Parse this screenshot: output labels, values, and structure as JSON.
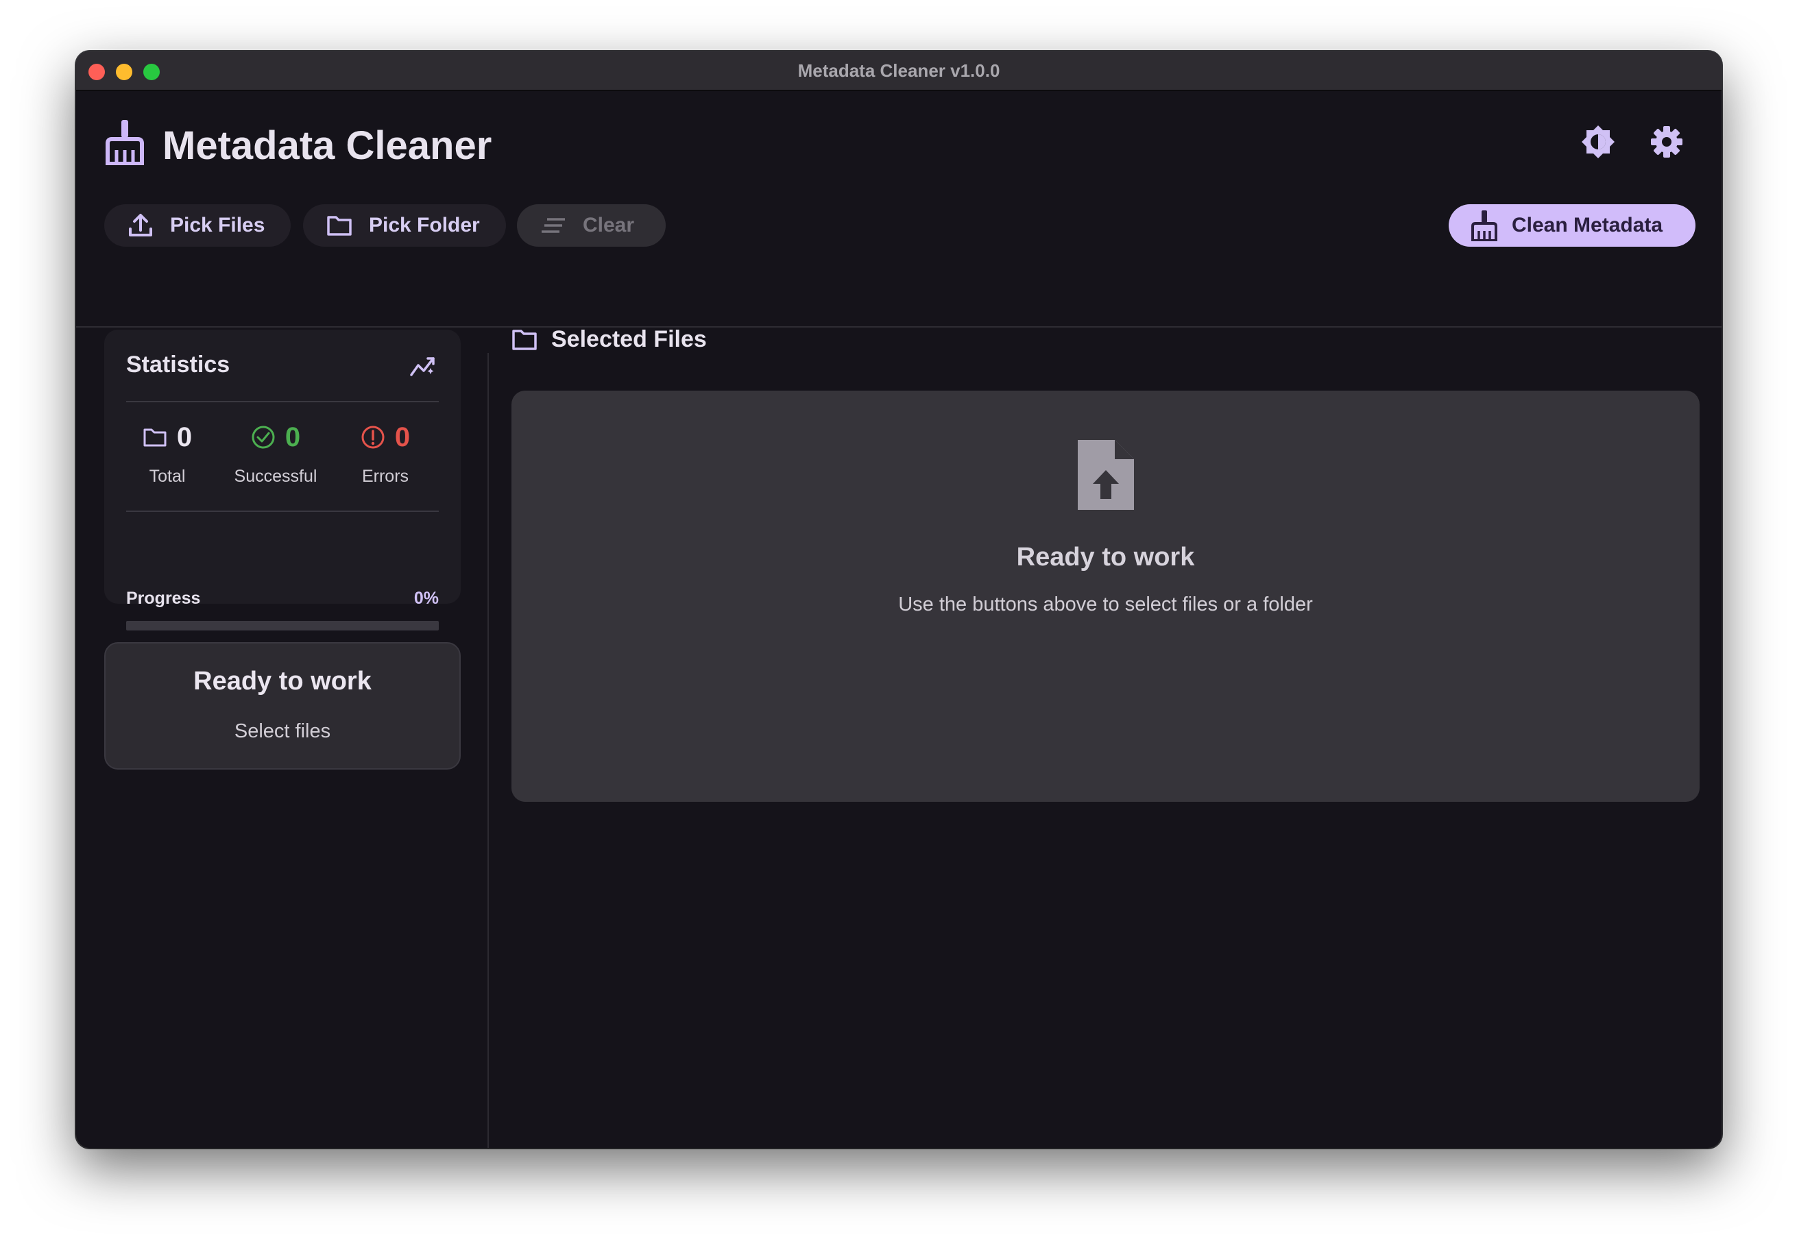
{
  "window": {
    "title": "Metadata Cleaner v1.0.0"
  },
  "header": {
    "app_title": "Metadata Cleaner",
    "app_icon": "broom-icon",
    "theme_icon": "brightness-icon",
    "settings_icon": "gear-icon"
  },
  "toolbar": {
    "pick_files_label": "Pick Files",
    "pick_folder_label": "Pick Folder",
    "clear_label": "Clear",
    "clean_label": "Clean Metadata"
  },
  "statistics": {
    "title": "Statistics",
    "total_value": "0",
    "total_label": "Total",
    "successful_value": "0",
    "successful_label": "Successful",
    "errors_value": "0",
    "errors_label": "Errors",
    "progress_label": "Progress",
    "progress_text": "0%",
    "progress_value": 0
  },
  "status_card": {
    "title": "Ready to work",
    "subtitle": "Select files"
  },
  "selected_files": {
    "title": "Selected Files",
    "empty_title": "Ready to work",
    "empty_subtitle": "Use the buttons above to select files or a folder"
  },
  "colors": {
    "accent": "#d1bcfa",
    "success": "#4caf50",
    "error": "#e5534b",
    "background": "#15131a"
  }
}
